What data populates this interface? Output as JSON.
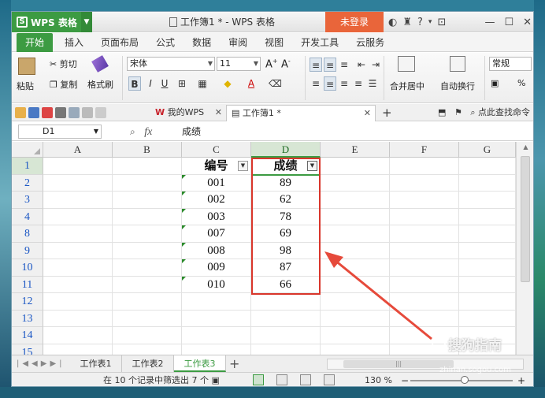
{
  "app": {
    "badge": "WPS 表格",
    "title": "工作簿1 * - WPS 表格",
    "login": "未登录"
  },
  "menu": [
    "开始",
    "插入",
    "页面布局",
    "公式",
    "数据",
    "审阅",
    "视图",
    "开发工具",
    "云服务"
  ],
  "ribbon": {
    "paste": "粘贴",
    "cut": "剪切",
    "copy": "复制",
    "format_painter": "格式刷",
    "font_name": "宋体",
    "font_size": "11",
    "merge_center": "合并居中",
    "wrap_text": "自动换行",
    "number_format": "常规",
    "percent": "%"
  },
  "doc_tabs": [
    {
      "label": "我的WPS"
    },
    {
      "label": "工作簿1 *"
    }
  ],
  "search_label": "点此查找命令",
  "formula_bar": {
    "cell_ref": "D1",
    "fx": "fx",
    "content": "成绩"
  },
  "columns": [
    "A",
    "B",
    "C",
    "D",
    "E",
    "F",
    "G"
  ],
  "rows": [
    {
      "num": "1",
      "id": "编号",
      "score": "成绩"
    },
    {
      "num": "2",
      "id": "001",
      "score": "89"
    },
    {
      "num": "3",
      "id": "002",
      "score": "62"
    },
    {
      "num": "4",
      "id": "003",
      "score": "78"
    },
    {
      "num": "8",
      "id": "007",
      "score": "69"
    },
    {
      "num": "9",
      "id": "008",
      "score": "98"
    },
    {
      "num": "10",
      "id": "009",
      "score": "87"
    },
    {
      "num": "11",
      "id": "010",
      "score": "66"
    },
    {
      "num": "12",
      "id": "",
      "score": ""
    },
    {
      "num": "13",
      "id": "",
      "score": ""
    },
    {
      "num": "14",
      "id": "",
      "score": ""
    },
    {
      "num": "15",
      "id": "",
      "score": ""
    }
  ],
  "sheets": [
    "工作表1",
    "工作表2",
    "工作表3"
  ],
  "status": {
    "filter_text": "在 10 个记录中筛选出 7 个",
    "zoom": "130 %"
  },
  "watermark": {
    "brand": "搜狗指南",
    "url": "zhinan.sogou.com"
  },
  "colors": {
    "brand_green": "#3c9b42",
    "login_orange": "#e9653a",
    "annotation_red": "#d9362b"
  }
}
